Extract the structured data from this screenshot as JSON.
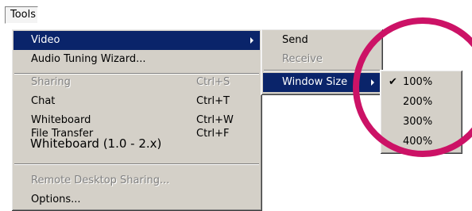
{
  "menubar": {
    "tools_label": "Tools"
  },
  "main_menu": {
    "items": [
      {
        "label": "Video",
        "shortcut": "",
        "state": "selected",
        "submenu": true
      },
      {
        "label": "Audio Tuning Wizard...",
        "shortcut": "",
        "state": "enabled"
      },
      {
        "label": "Sharing",
        "shortcut": "Ctrl+S",
        "state": "disabled"
      },
      {
        "label": "Chat",
        "shortcut": "Ctrl+T",
        "state": "enabled"
      },
      {
        "label": "Whiteboard",
        "shortcut": "Ctrl+W",
        "state": "enabled"
      },
      {
        "label": "File Transfer",
        "shortcut": "Ctrl+F",
        "state": "enabled"
      },
      {
        "label": "Remote Desktop Sharing...",
        "shortcut": "",
        "state": "disabled"
      },
      {
        "label": "Options...",
        "shortcut": "",
        "state": "enabled"
      }
    ],
    "overlay_note": "Whiteboard (1.0 - 2.x)"
  },
  "video_submenu": {
    "items": [
      {
        "label": "Send",
        "state": "enabled"
      },
      {
        "label": "Receive",
        "state": "disabled"
      },
      {
        "label": "Window Size",
        "state": "selected",
        "submenu": true
      }
    ]
  },
  "window_size_submenu": {
    "items": [
      {
        "label": "100%",
        "checked": true
      },
      {
        "label": "200%",
        "checked": false
      },
      {
        "label": "300%",
        "checked": false
      },
      {
        "label": "400%",
        "checked": false
      }
    ],
    "check_glyph": "✔"
  },
  "colors": {
    "menu_bg": "#d4d0c8",
    "selection": "#0a246a",
    "disabled_text": "#808080",
    "annotation_circle": "#cc1266"
  }
}
